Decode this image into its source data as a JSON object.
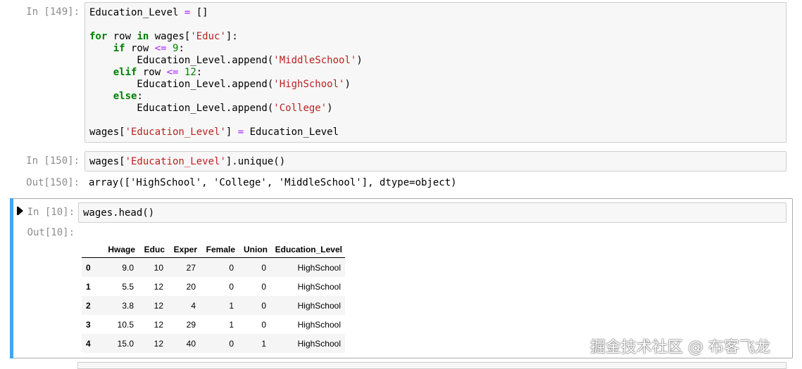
{
  "cell149": {
    "prompt": "In [149]:",
    "lines": [
      "Education_Level = []",
      "",
      "for row in wages['Educ']:",
      "    if row <= 9:",
      "        Education_Level.append('MiddleSchool')",
      "    elif row <= 12:",
      "        Education_Level.append('HighSchool')",
      "    else:",
      "        Education_Level.append('College')",
      "",
      "wages['Education_Level'] = Education_Level"
    ]
  },
  "cell150": {
    "prompt": "In [150]:",
    "code": "wages['Education_Level'].unique()",
    "out_prompt": "Out[150]:",
    "output": "array(['HighSchool', 'College', 'MiddleSchool'], dtype=object)"
  },
  "cell10": {
    "prompt": "In [10]:",
    "code": "wages.head()",
    "out_prompt": "Out[10]:",
    "table": {
      "columns": [
        "",
        "Hwage",
        "Educ",
        "Exper",
        "Female",
        "Union",
        "Education_Level"
      ],
      "rows": [
        [
          "0",
          "9.0",
          "10",
          "27",
          "0",
          "0",
          "HighSchool"
        ],
        [
          "1",
          "5.5",
          "12",
          "20",
          "0",
          "0",
          "HighSchool"
        ],
        [
          "2",
          "3.8",
          "12",
          "4",
          "1",
          "0",
          "HighSchool"
        ],
        [
          "3",
          "10.5",
          "12",
          "29",
          "1",
          "0",
          "HighSchool"
        ],
        [
          "4",
          "15.0",
          "12",
          "40",
          "0",
          "1",
          "HighSchool"
        ]
      ]
    }
  },
  "watermark": "掘金技术社区 @ 布客飞龙",
  "colors": {
    "keyword": "#008000",
    "string": "#ba2121",
    "operator": "#aa22ff",
    "selected_bar": "#42a5f5",
    "prompt": "#8c8c8c"
  }
}
